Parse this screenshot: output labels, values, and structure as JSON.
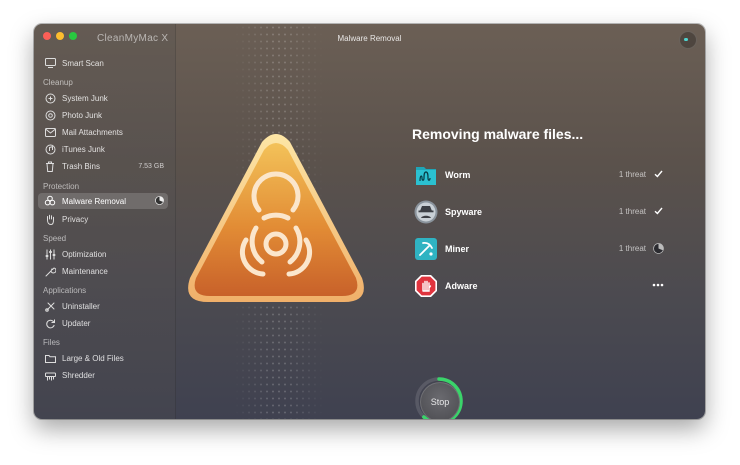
{
  "window": {
    "app_name": "CleanMyMac X",
    "title": "Malware Removal"
  },
  "sidebar": {
    "smart_scan": "Smart Scan",
    "sections": {
      "cleanup": "Cleanup",
      "protection": "Protection",
      "speed": "Speed",
      "applications": "Applications",
      "files": "Files"
    },
    "items": {
      "system_junk": "System Junk",
      "photo_junk": "Photo Junk",
      "mail_attachments": "Mail Attachments",
      "itunes_junk": "iTunes Junk",
      "trash_bins": "Trash Bins",
      "trash_bins_size": "7.53 GB",
      "malware_removal": "Malware Removal",
      "privacy": "Privacy",
      "optimization": "Optimization",
      "maintenance": "Maintenance",
      "uninstaller": "Uninstaller",
      "updater": "Updater",
      "large_old_files": "Large & Old Files",
      "shredder": "Shredder"
    }
  },
  "main": {
    "heading": "Removing malware files...",
    "threats": [
      {
        "name": "Worm",
        "count": "1 threat",
        "status": "done",
        "icon": "worm-icon"
      },
      {
        "name": "Spyware",
        "count": "1 threat",
        "status": "done",
        "icon": "spyware-icon"
      },
      {
        "name": "Miner",
        "count": "1 threat",
        "status": "in-progress",
        "icon": "miner-icon"
      },
      {
        "name": "Adware",
        "count": "",
        "status": "pending",
        "icon": "adware-icon"
      }
    ],
    "stop_label": "Stop",
    "progress": 0.62
  },
  "colors": {
    "accent_green": "#3ad46a",
    "hazard_orange": "#e89a3a",
    "worm_teal": "#1fa6b8",
    "spyware_grey": "#8a939c",
    "miner_teal": "#2fb3c2",
    "adware_red": "#e0343e"
  }
}
